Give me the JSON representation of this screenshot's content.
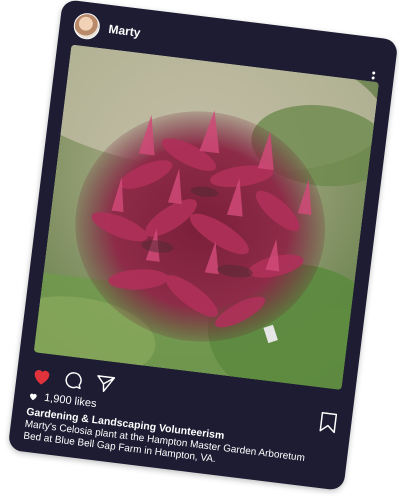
{
  "post": {
    "username": "Marty",
    "likes": "1,900 likes",
    "caption_title": "Gardening & Landscaping Volunteerism",
    "caption_text": "Marty's Celosia plant at the Hampton Master Garden Arboretum Bed at Blue Bell Gap Farm in Hampton, VA.",
    "liked": true
  },
  "icons": {
    "avatar": "user-avatar",
    "more": "more-vertical-icon",
    "like": "heart-icon",
    "comment": "comment-icon",
    "share": "send-icon",
    "bookmark": "bookmark-icon"
  },
  "colors": {
    "card_background": "#1d1c33",
    "like_red": "#e0323a",
    "text": "#ffffff"
  }
}
